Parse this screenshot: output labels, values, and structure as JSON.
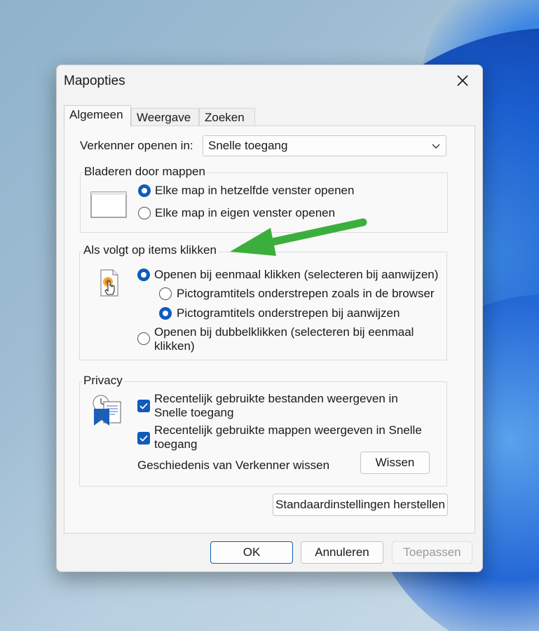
{
  "dialog": {
    "title": "Mapopties",
    "tabs": [
      "Algemeen",
      "Weergave",
      "Zoeken"
    ]
  },
  "general": {
    "open_label": "Verkenner openen in:",
    "open_value": "Snelle toegang",
    "browse_group": "Bladeren door mappen",
    "browse_same": "Elke map in hetzelfde venster openen",
    "browse_own": "Elke map in eigen venster openen",
    "click_group": "Als volgt op items klikken",
    "single_click": "Openen bij eenmaal klikken (selecteren bij aanwijzen)",
    "underline_browser": "Pictogramtitels onderstrepen zoals in de browser",
    "underline_hover": "Pictogramtitels onderstrepen bij aanwijzen",
    "double_click_line1": "Openen bij dubbelklikken (selecteren bij eenmaal",
    "double_click_line2": "klikken)",
    "privacy_group": "Privacy",
    "recent_files_line1": "Recentelijk gebruikte bestanden weergeven in",
    "recent_files_line2": "Snelle toegang",
    "recent_folders_line1": "Recentelijk gebruikte mappen weergeven in Snelle",
    "recent_folders_line2": "toegang",
    "history_label": "Geschiedenis van Verkenner wissen",
    "clear_button": "Wissen",
    "restore_button": "Standaardinstellingen herstellen"
  },
  "footer": {
    "ok": "OK",
    "cancel": "Annuleren",
    "apply": "Toepassen"
  },
  "state": {
    "browse_selected": "same",
    "click_selected": "single",
    "underline_selected": "hover",
    "recent_files_checked": true,
    "recent_folders_checked": true,
    "apply_enabled": false
  },
  "colors": {
    "accent": "#0f5bbd",
    "arrow": "#3cae3c"
  }
}
